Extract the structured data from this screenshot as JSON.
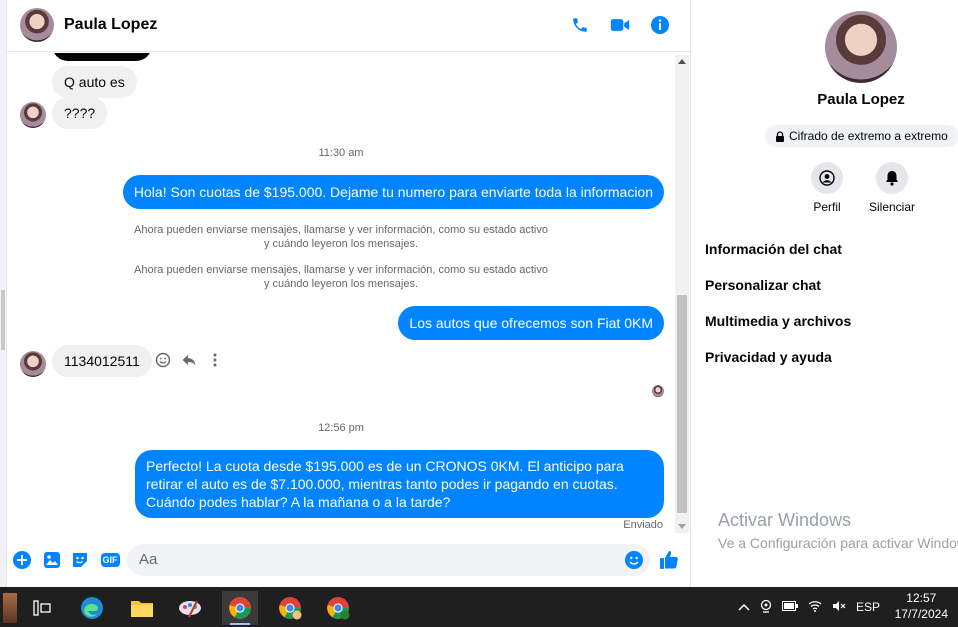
{
  "chat": {
    "contact_name": "Paula Lopez",
    "header_icons": [
      "phone-icon",
      "video-icon",
      "info-icon"
    ]
  },
  "messages": {
    "incoming_1": "Q auto es",
    "incoming_2": "????",
    "time_1": "11:30 am",
    "outgoing_1": "Hola! Son cuotas de $195.000. Dejame tu numero para enviarte toda la informacion",
    "system_1_line1": "Ahora pueden enviarse mensajes, llamarse y ver información, como su estado activo",
    "system_1_line2": "y cuándo leyeron los mensajes.",
    "system_2_line1": "Ahora pueden enviarse mensajes, llamarse y ver información, como su estado activo",
    "system_2_line2": "y cuándo leyeron los mensajes.",
    "outgoing_2": "Los autos que ofrecemos son Fiat 0KM",
    "incoming_3": "1134012511",
    "time_2": "12:56 pm",
    "outgoing_3": "Perfecto! La cuota desde $195.000 es de un CRONOS 0KM. El anticipo para retirar el auto es de $7.100.000, mientras tanto podes ir pagando en cuotas. Cuándo podes hablar? A la mañana o a la tarde?",
    "status": "Enviado"
  },
  "composer": {
    "placeholder": "Aa",
    "gif_label": "GIF"
  },
  "panel": {
    "name": "Paula Lopez",
    "encryption": "Cifrado de extremo a extremo",
    "profile_label": "Perfil",
    "mute_label": "Silenciar",
    "menu": [
      "Información del chat",
      "Personalizar chat",
      "Multimedia y archivos",
      "Privacidad y ayuda"
    ]
  },
  "watermark": {
    "line1": "Activar Windows",
    "line2": "Ve a Configuración para activar Windows."
  },
  "taskbar": {
    "lang": "ESP",
    "time": "12:57",
    "date": "17/7/2024"
  },
  "colors": {
    "accent": "#0084ff",
    "incoming_bubble": "#f0f0f0",
    "taskbar": "#1f1f1f"
  }
}
